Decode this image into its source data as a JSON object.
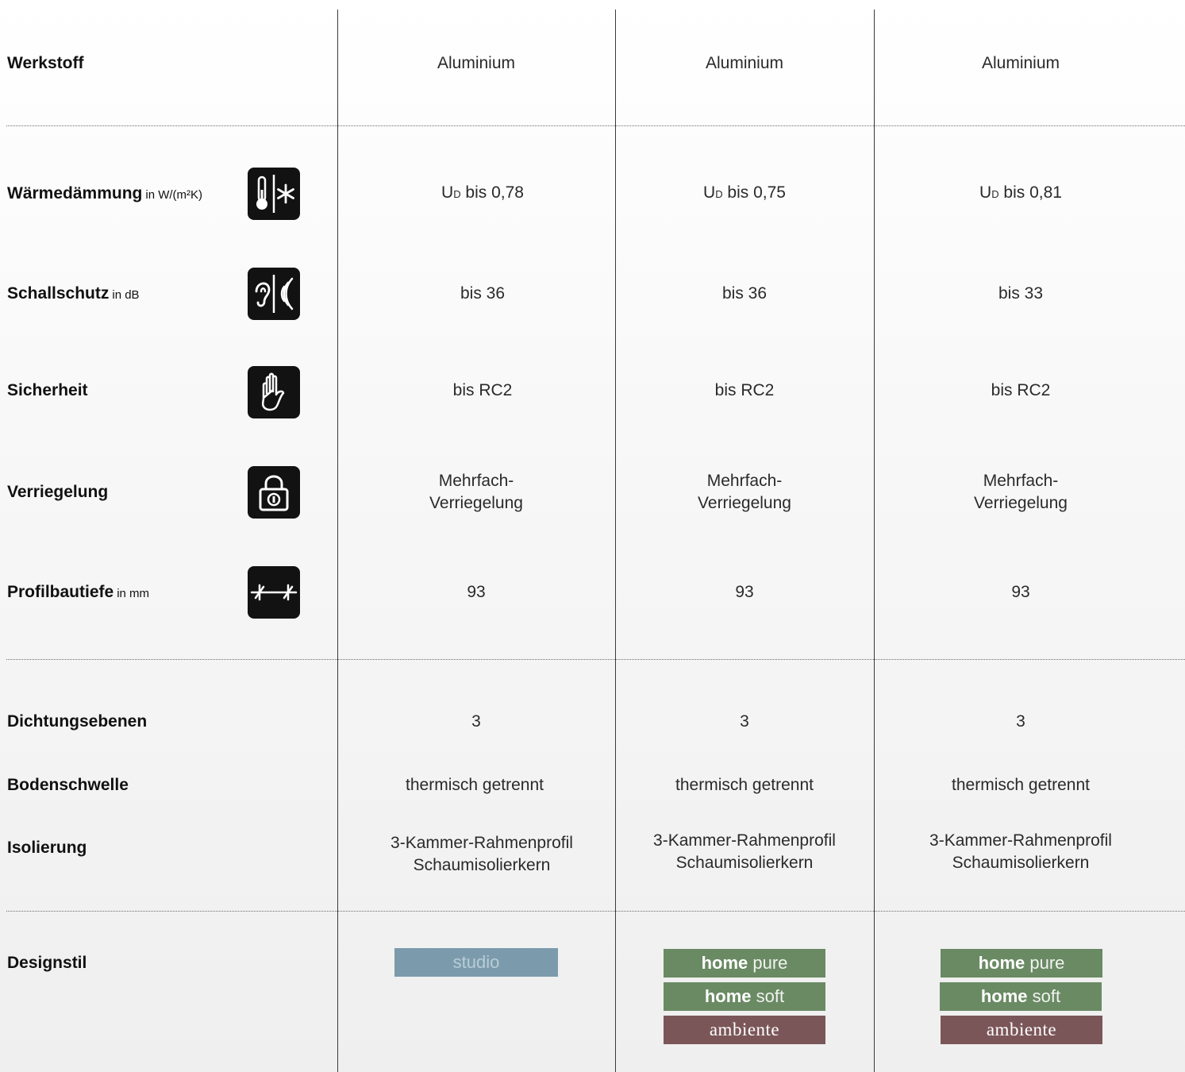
{
  "rows": {
    "werkstoff": {
      "label": "Werkstoff",
      "unit": "",
      "values": [
        "Aluminium",
        "Aluminium",
        "Aluminium"
      ]
    },
    "waermedaemmung": {
      "label": "Wärmedämmung",
      "unit": "in W/(m²K)",
      "icon": "thermometer-snowflake-icon",
      "values": [
        {
          "prefix": "U",
          "sub": "D",
          "text": " bis 0,78"
        },
        {
          "prefix": "U",
          "sub": "D",
          "text": " bis 0,75"
        },
        {
          "prefix": "U",
          "sub": "D",
          "text": " bis 0,81"
        }
      ]
    },
    "schallschutz": {
      "label": "Schallschutz",
      "unit": "in dB",
      "icon": "ear-soundwave-icon",
      "values": [
        "bis 36",
        "bis 36",
        "bis 33"
      ]
    },
    "sicherheit": {
      "label": "Sicherheit",
      "unit": "",
      "icon": "hand-icon",
      "values": [
        "bis RC2",
        "bis RC2",
        "bis RC2"
      ]
    },
    "verriegelung": {
      "label": "Verriegelung",
      "unit": "",
      "icon": "padlock-icon",
      "values": [
        [
          "Mehrfach-",
          "Verriegelung"
        ],
        [
          "Mehrfach-",
          "Verriegelung"
        ],
        [
          "Mehrfach-",
          "Verriegelung"
        ]
      ]
    },
    "profilbautiefe": {
      "label": "Profilbautiefe",
      "unit": "in mm",
      "icon": "depth-measure-icon",
      "values": [
        "93",
        "93",
        "93"
      ]
    },
    "dichtungsebenen": {
      "label": "Dichtungsebenen",
      "unit": "",
      "values": [
        "3",
        "3",
        "3"
      ]
    },
    "bodenschwelle": {
      "label": "Bodenschwelle",
      "unit": "",
      "values": [
        "thermisch getrennt",
        "thermisch getrennt",
        "thermisch getrennt"
      ]
    },
    "isolierung": {
      "label": "Isolierung",
      "unit": "",
      "values": [
        [
          "3-Kammer-Rahmenprofil",
          "Schaumisolierkern"
        ],
        [
          "3-Kammer-Rahmenprofil",
          "Schaumisolierkern"
        ],
        [
          "3-Kammer-Rahmenprofil",
          "Schaumisolierkern"
        ]
      ]
    },
    "designstil": {
      "label": "Designstil",
      "unit": ""
    }
  },
  "design": {
    "studio": "studio",
    "home": "home",
    "pure": "pure",
    "soft": "soft",
    "ambiente": "ambiente"
  },
  "colors": {
    "studio": "#7b9bad",
    "home_green": "#6a8a63",
    "ambiente": "#7b5659",
    "icon_bg": "#121212"
  }
}
